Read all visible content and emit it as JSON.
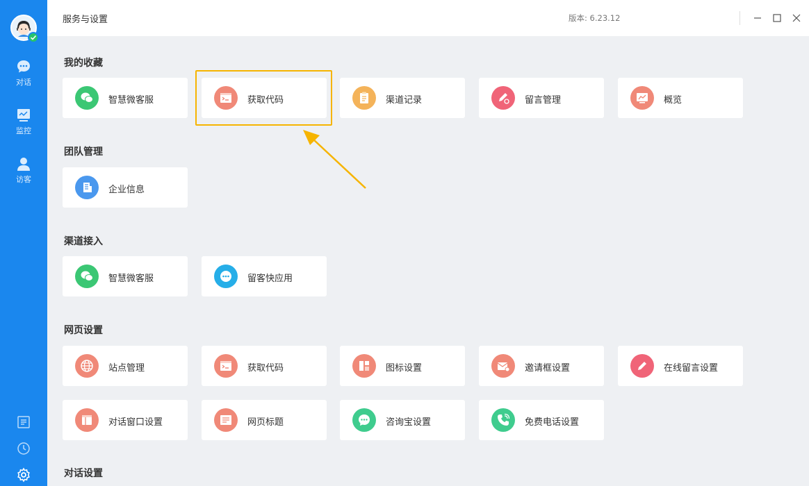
{
  "sidebar": {
    "nav": [
      {
        "label": "对话",
        "icon": "chat-bubble-icon"
      },
      {
        "label": "监控",
        "icon": "monitor-icon"
      },
      {
        "label": "访客",
        "icon": "visitor-icon"
      }
    ],
    "bottom_icons": [
      "notes-icon",
      "clock-icon",
      "gear-icon"
    ]
  },
  "header": {
    "title": "服务与设置",
    "version": "版本: 6.23.12"
  },
  "sections": {
    "favorites": {
      "title": "我的收藏",
      "items": [
        {
          "label": "智慧微客服",
          "icon": "wechat-icon",
          "color": "#3bc774"
        },
        {
          "label": "获取代码",
          "icon": "code-window-icon",
          "color": "#f08978"
        },
        {
          "label": "渠道记录",
          "icon": "clipboard-icon",
          "color": "#f4b35a"
        },
        {
          "label": "留言管理",
          "icon": "pen-icon",
          "color": "#f06478"
        },
        {
          "label": "概览",
          "icon": "overview-icon",
          "color": "#f08978"
        }
      ]
    },
    "team": {
      "title": "团队管理",
      "items": [
        {
          "label": "企业信息",
          "icon": "building-icon",
          "color": "#4a98ee"
        }
      ]
    },
    "channels": {
      "title": "渠道接入",
      "items": [
        {
          "label": "智慧微客服",
          "icon": "wechat-icon",
          "color": "#3bc774"
        },
        {
          "label": "留客快应用",
          "icon": "quick-app-icon",
          "color": "#26aee8"
        }
      ]
    },
    "web": {
      "title": "网页设置",
      "items": [
        {
          "label": "站点管理",
          "icon": "globe-icon",
          "color": "#f08978"
        },
        {
          "label": "获取代码",
          "icon": "code-window-icon",
          "color": "#f08978"
        },
        {
          "label": "图标设置",
          "icon": "layout-icon",
          "color": "#f08978"
        },
        {
          "label": "邀请框设置",
          "icon": "envelope-icon",
          "color": "#f08978"
        },
        {
          "label": "在线留言设置",
          "icon": "pen-icon",
          "color": "#f06478"
        },
        {
          "label": "对话窗口设置",
          "icon": "window-icon",
          "color": "#f08978"
        },
        {
          "label": "网页标题",
          "icon": "page-title-icon",
          "color": "#f08978"
        },
        {
          "label": "咨询宝设置",
          "icon": "chat-dots-icon",
          "color": "#3fcc8e"
        },
        {
          "label": "免费电话设置",
          "icon": "phone-icon",
          "color": "#3fcc8e"
        }
      ]
    },
    "dialog": {
      "title": "对话设置"
    }
  },
  "colors": {
    "sidebar": "#1a87ee",
    "highlight": "#f6b400",
    "background": "#eef0f3"
  }
}
